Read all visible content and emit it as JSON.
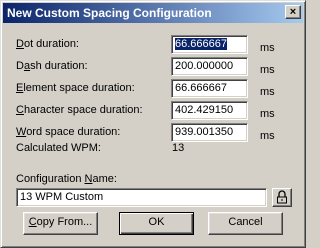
{
  "window": {
    "title": "New Custom Spacing Configuration",
    "close_label": "×"
  },
  "fields": [
    {
      "pre": "",
      "accel": "D",
      "post": "ot duration:",
      "value": "66.666667",
      "unit": "ms"
    },
    {
      "pre": "D",
      "accel": "a",
      "post": "sh duration:",
      "value": "200.000000",
      "unit": "ms"
    },
    {
      "pre": "",
      "accel": "E",
      "post": "lement space duration:",
      "value": "66.666667",
      "unit": "ms"
    },
    {
      "pre": "",
      "accel": "C",
      "post": "haracter space duration:",
      "value": "402.429150",
      "unit": "ms"
    },
    {
      "pre": "",
      "accel": "W",
      "post": "ord space duration:",
      "value": "939.001350",
      "unit": "ms"
    }
  ],
  "wpm": {
    "label": "Calculated WPM:",
    "value": "13"
  },
  "config_name": {
    "pre": "Configuration ",
    "accel": "N",
    "post": "ame:",
    "value": "13 WPM Custom"
  },
  "buttons": {
    "copy_accel": "C",
    "copy_rest": "opy From...",
    "ok": "OK",
    "cancel": "Cancel"
  },
  "icons": {
    "lock": "padlock-icon"
  }
}
